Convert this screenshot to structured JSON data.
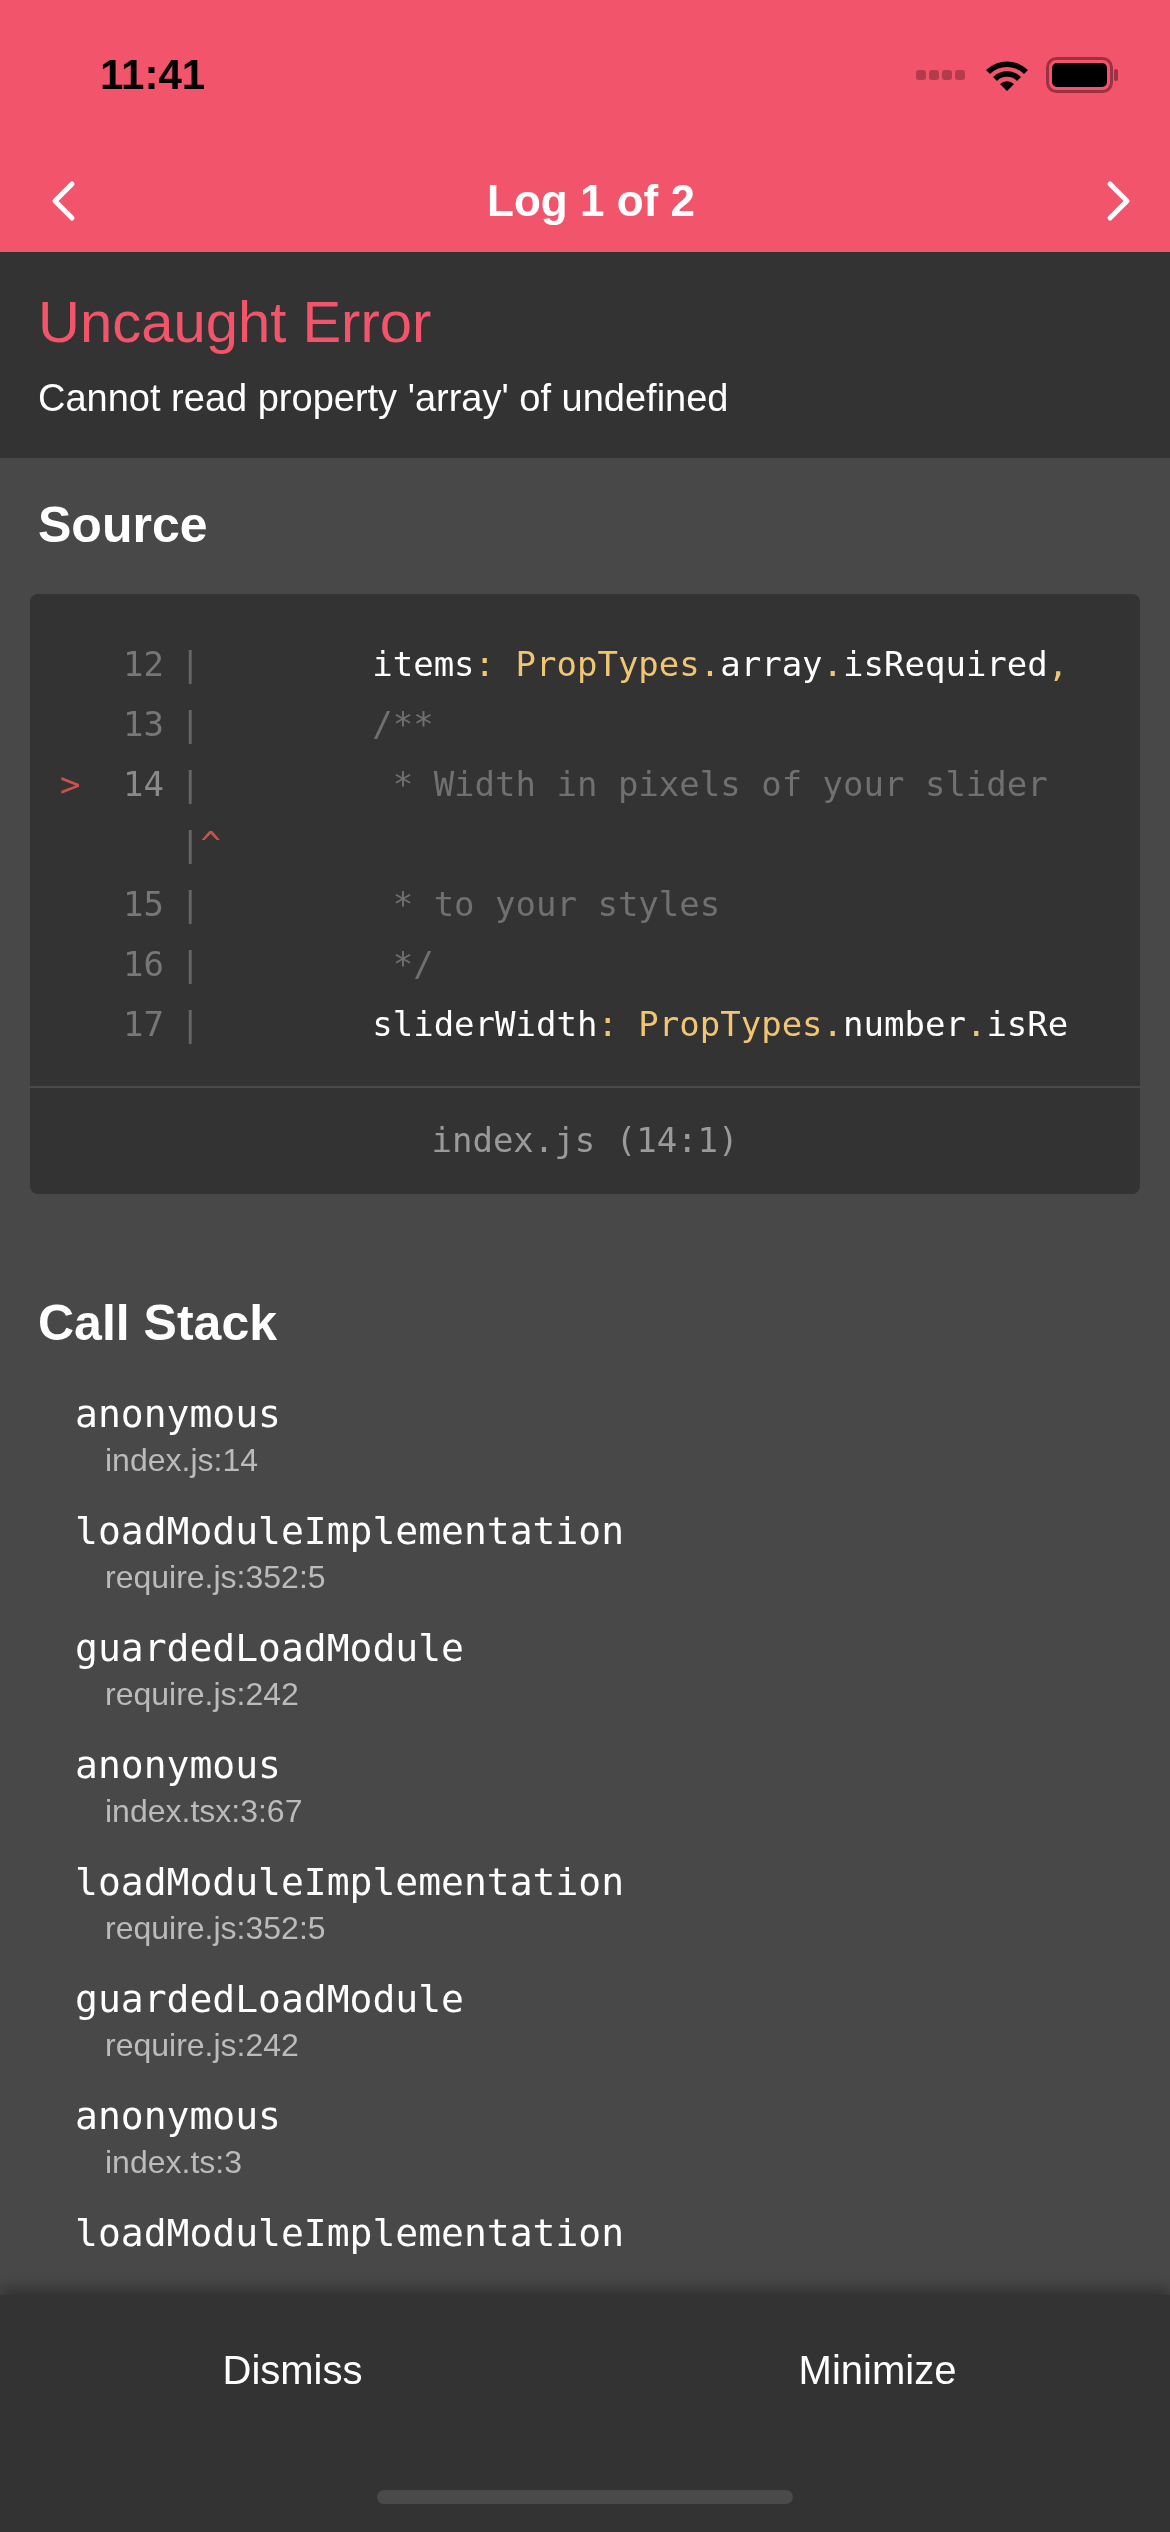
{
  "status_bar": {
    "time": "11:41"
  },
  "nav": {
    "title": "Log 1 of 2"
  },
  "error": {
    "title": "Uncaught Error",
    "message": "Cannot read property 'array' of undefined"
  },
  "source": {
    "heading": "Source",
    "file": "index.js (14:1)",
    "lines": [
      {
        "kind": "code",
        "number": "12",
        "gutter": "|",
        "highlighted": false,
        "segments": [
          {
            "kind": "plain",
            "text": "        items"
          },
          {
            "kind": "accent",
            "text": ": PropTypes."
          },
          {
            "kind": "plain",
            "text": "array"
          },
          {
            "kind": "accent",
            "text": "."
          },
          {
            "kind": "plain",
            "text": "isRequired"
          },
          {
            "kind": "accent",
            "text": ","
          }
        ]
      },
      {
        "kind": "code",
        "number": "13",
        "gutter": "|",
        "highlighted": false,
        "segments": [
          {
            "kind": "comment",
            "text": "        /**"
          }
        ]
      },
      {
        "kind": "code",
        "number": "14",
        "gutter": "|",
        "highlighted": true,
        "marker": ">",
        "segments": [
          {
            "kind": "comment",
            "text": "         * Width in pixels of your slider"
          }
        ]
      },
      {
        "kind": "caret",
        "gutter": "|",
        "marker": "^"
      },
      {
        "kind": "code",
        "number": "15",
        "gutter": "|",
        "highlighted": false,
        "segments": [
          {
            "kind": "comment",
            "text": "         * to your styles"
          }
        ]
      },
      {
        "kind": "code",
        "number": "16",
        "gutter": "|",
        "highlighted": false,
        "segments": [
          {
            "kind": "comment",
            "text": "         */"
          }
        ]
      },
      {
        "kind": "code",
        "number": "17",
        "gutter": "|",
        "highlighted": false,
        "segments": [
          {
            "kind": "plain",
            "text": "        sliderWidth"
          },
          {
            "kind": "accent",
            "text": ": PropTypes."
          },
          {
            "kind": "plain",
            "text": "number"
          },
          {
            "kind": "accent",
            "text": "."
          },
          {
            "kind": "plain",
            "text": "isRe"
          }
        ]
      }
    ]
  },
  "call_stack": {
    "heading": "Call Stack",
    "frames": [
      {
        "name": "anonymous",
        "location": "index.js:14"
      },
      {
        "name": "loadModuleImplementation",
        "location": "require.js:352:5"
      },
      {
        "name": "guardedLoadModule",
        "location": "require.js:242"
      },
      {
        "name": "anonymous",
        "location": "index.tsx:3:67"
      },
      {
        "name": "loadModuleImplementation",
        "location": "require.js:352:5"
      },
      {
        "name": "guardedLoadModule",
        "location": "require.js:242"
      },
      {
        "name": "anonymous",
        "location": "index.ts:3"
      },
      {
        "name": "loadModuleImplementation"
      }
    ]
  },
  "buttons": [
    "Dismiss",
    "Minimize"
  ]
}
